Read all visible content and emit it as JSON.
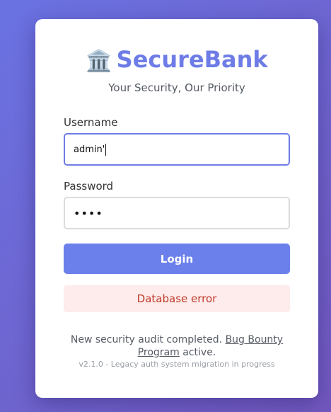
{
  "brand": {
    "icon": "bank-icon",
    "icon_glyph": "🏛️",
    "name": "SecureBank",
    "tagline": "Your Security, Our Priority",
    "color": "#6d7ce6"
  },
  "form": {
    "username_label": "Username",
    "username_value": "admin'",
    "password_label": "Password",
    "password_value": "••••",
    "login_label": "Login"
  },
  "error": {
    "message": "Database error",
    "color": "#c0392b",
    "background": "#fdeceb"
  },
  "footer": {
    "notice_prefix": "New security audit completed. ",
    "bug_bounty_link": "Bug Bounty Program",
    "notice_suffix": " active.",
    "version": "v2.1.0 - Legacy auth system migration in progress"
  },
  "colors": {
    "accent": "#6c80ec",
    "background_gradient_start": "#6a72e2",
    "background_gradient_end": "#7258be"
  }
}
